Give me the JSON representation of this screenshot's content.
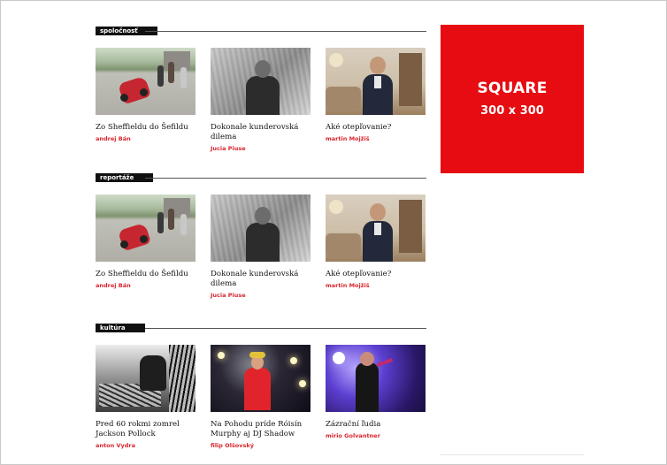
{
  "sections": [
    {
      "label": "spoločnosť",
      "articles": [
        {
          "title": "Zo Sheffieldu do Šefildu",
          "author": "andrej Bán",
          "image": "street-car-photo"
        },
        {
          "title": "Dokonale kunderovská dilema",
          "author": "Jucia Piuse",
          "image": "portrait-bw-photo"
        },
        {
          "title": "Aké otepľovanie?",
          "author": "martin Mojžiš",
          "image": "office-portrait-photo"
        }
      ]
    },
    {
      "label": "reportáže",
      "articles": [
        {
          "title": "Zo Sheffieldu do Šefildu",
          "author": "andrej Bán",
          "image": "street-car-photo"
        },
        {
          "title": "Dokonale kunderovská dilema",
          "author": "Jucia Piuse",
          "image": "portrait-bw-photo"
        },
        {
          "title": "Aké otepľovanie?",
          "author": "martin Mojžiš",
          "image": "office-portrait-photo"
        }
      ]
    },
    {
      "label": "kultúra",
      "articles": [
        {
          "title": "Pred 60 rokmi zomrel Jackson Pollock",
          "author": "anton Vydra",
          "image": "pollock-bw-photo"
        },
        {
          "title": "Na Pohodu príde Róisín Murphy aj DJ Shadow",
          "author": "filip Olšovský",
          "image": "stage-performer-photo"
        },
        {
          "title": "Zázrační ľudia",
          "author": "mirio Golvantner",
          "image": "concert-singer-photo"
        }
      ]
    }
  ],
  "ad": {
    "title": "SQUARE",
    "size": "300 x 300",
    "color": "#e60c12"
  },
  "colors": {
    "accent": "#d8262e",
    "label_bg": "#111111"
  }
}
